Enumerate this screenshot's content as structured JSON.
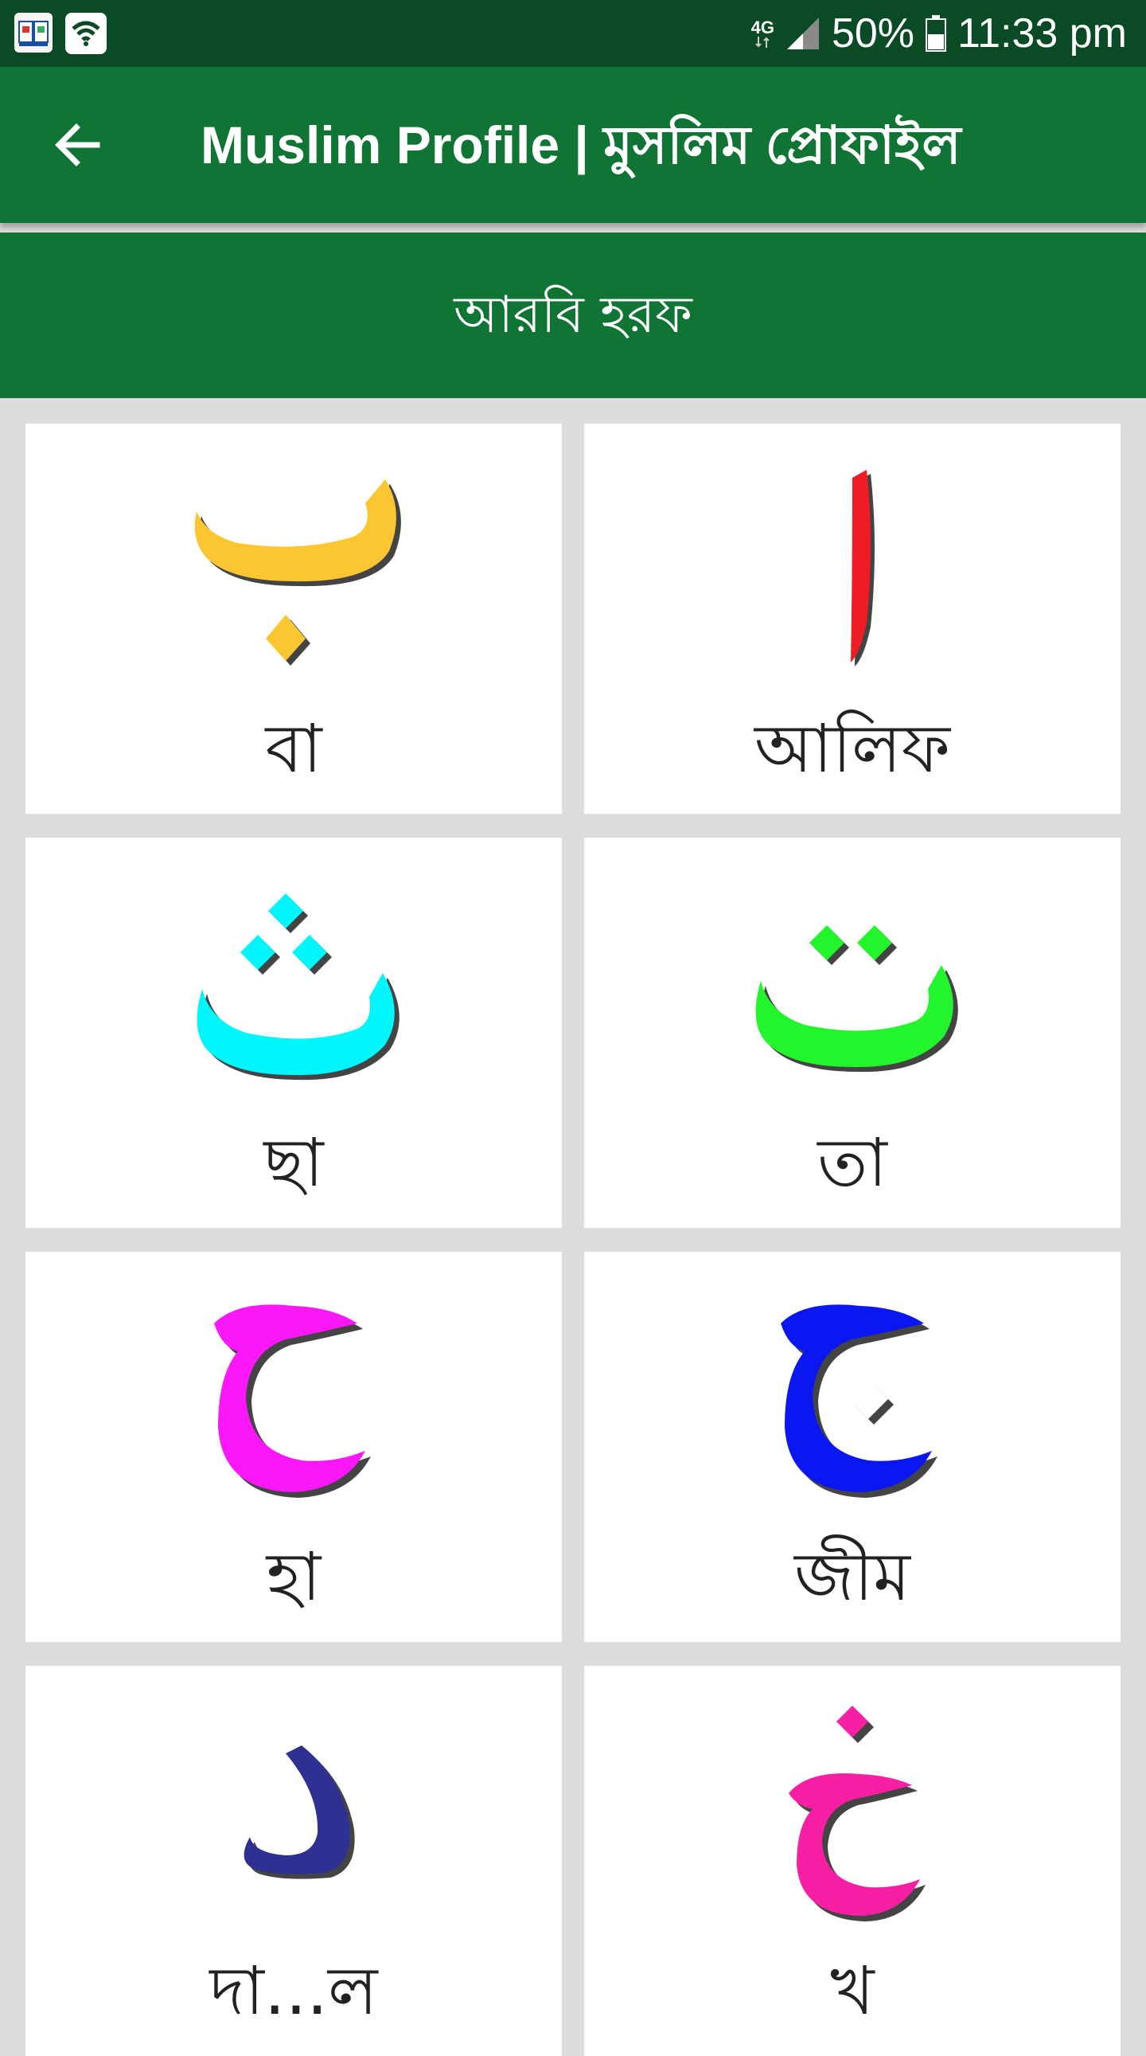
{
  "status_bar": {
    "network": "4G",
    "battery": "50%",
    "time": "11:33 pm"
  },
  "app_bar": {
    "title": "Muslim Profile | মুসলিম প্রোফাইল"
  },
  "section": {
    "title": "আরবি হরফ"
  },
  "letters": [
    {
      "name": "বা",
      "color": "#fcc532",
      "icon": "arabic-ba"
    },
    {
      "name": "আলিফ",
      "color": "#ee1c25",
      "icon": "arabic-alif"
    },
    {
      "name": "ছা",
      "color": "#00f6fb",
      "icon": "arabic-tha"
    },
    {
      "name": "তা",
      "color": "#22f52b",
      "icon": "arabic-ta"
    },
    {
      "name": "হা",
      "color": "#fb18f8",
      "icon": "arabic-ha"
    },
    {
      "name": "জীম",
      "color": "#0a17f0",
      "icon": "arabic-jim"
    },
    {
      "name": "দা...ল",
      "color": "#2e3192",
      "icon": "arabic-dal"
    },
    {
      "name": "খ",
      "color": "#f91fa4",
      "icon": "arabic-kha"
    }
  ],
  "colors": {
    "status_bar": "#0a4a24",
    "primary": "#0f7434",
    "background": "#dcdcdc"
  }
}
